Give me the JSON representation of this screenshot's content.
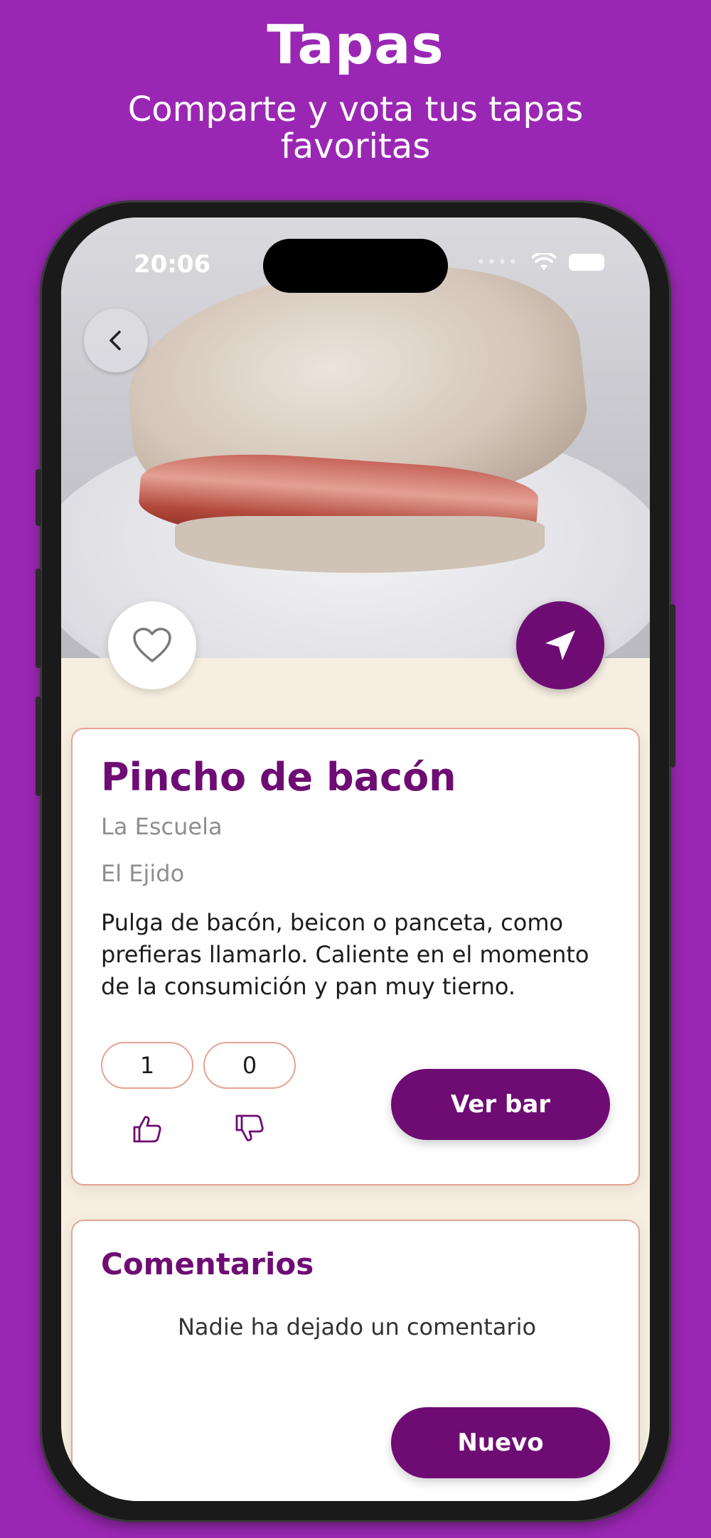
{
  "promo": {
    "title": "Tapas",
    "subtitle": "Comparte y vota tus tapas favoritas"
  },
  "status_bar": {
    "time": "20:06",
    "signal_icon": "cellular-signal-icon",
    "wifi_icon": "wifi-icon",
    "battery_icon": "battery-icon"
  },
  "header": {
    "back_icon": "chevron-left-icon",
    "favorite_icon": "heart-outline-icon",
    "navigate_icon": "location-arrow-icon"
  },
  "tapa": {
    "name": "Pincho de bacón",
    "bar": "La Escuela",
    "town": "El Ejido",
    "description": "Pulga de bacón, beicon o panceta, como prefieras llamarlo. Caliente en el momento de la consumición y pan muy tierno.",
    "likes": "1",
    "dislikes": "0",
    "ver_bar_label": "Ver bar"
  },
  "comments": {
    "title": "Comentarios",
    "empty_message": "Nadie ha dejado un comentario",
    "new_label": "Nuevo"
  },
  "colors": {
    "background": "#9a27b3",
    "accent": "#6e0c74",
    "card_border": "#e5a393",
    "screen_bg": "#f6efe1"
  }
}
